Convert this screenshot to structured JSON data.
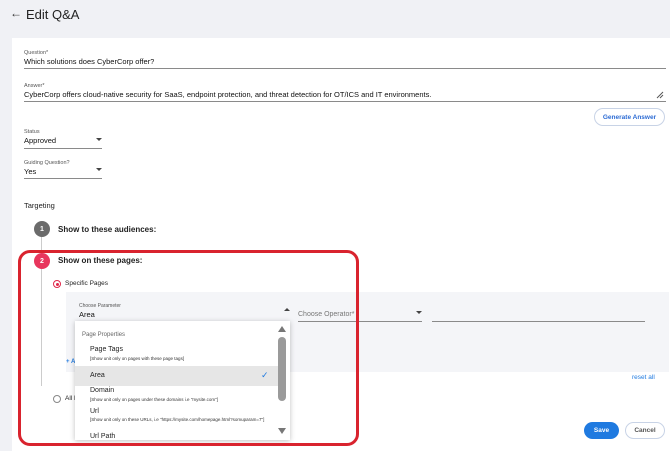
{
  "header": {
    "back_glyph": "←",
    "title": "Edit Q&A"
  },
  "form": {
    "question": {
      "label": "Question*",
      "value": "Which solutions does CyberCorp offer?"
    },
    "answer": {
      "label": "Answer*",
      "value": "CyberCorp offers cloud-native security for SaaS, endpoint protection, and threat detection for OT/ICS and IT environments."
    },
    "generate_answer": "Generate Answer",
    "status": {
      "label": "Status",
      "value": "Approved"
    },
    "guiding": {
      "label": "Guiding Question?",
      "value": "Yes"
    }
  },
  "targeting": {
    "heading": "Targeting",
    "step1": {
      "num": "1",
      "label": "Show to these audiences:"
    },
    "step2": {
      "num": "2",
      "label": "Show on these pages:"
    },
    "specific_pages": "Specific Pages",
    "all_pages": "All P",
    "add_link": "+ A",
    "reset_all": "reset all",
    "parameter": {
      "label": "Choose Parameter",
      "value": "Area"
    },
    "operator": {
      "placeholder": "Choose Operator*"
    }
  },
  "dropdown": {
    "group": "Page Properties",
    "items": [
      {
        "title": "Page Tags",
        "sub": "[Show unit only on pages with these page tags]",
        "selected": false
      },
      {
        "title": "Area",
        "sub": "",
        "selected": true
      },
      {
        "title": "Domain",
        "sub": "[Show unit only on pages under these domains i.e \"mysite.com\"]",
        "selected": false
      },
      {
        "title": "Url",
        "sub": "[Show unit only on these URLs, i.e \"https://mysite.com/homepage.html?somuparam=7\"]",
        "selected": false
      },
      {
        "title": "Url Path",
        "sub": "",
        "selected": false
      }
    ]
  },
  "actions": {
    "save": "Save",
    "cancel": "Cancel"
  },
  "colors": {
    "accent": "#1f7ae0",
    "step_active": "#e8365d",
    "step_inactive": "#6b6b6b",
    "highlight": "#d9232e"
  }
}
